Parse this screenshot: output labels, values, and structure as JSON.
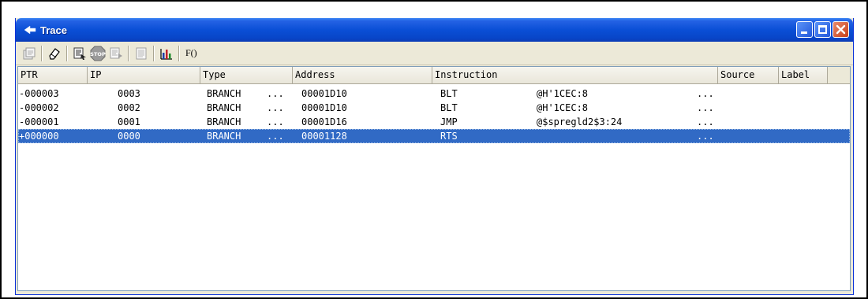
{
  "window": {
    "title": "Trace"
  },
  "toolbar": {
    "buttons": [
      {
        "icon": "properties-icon"
      },
      {
        "icon": "eraser-icon"
      },
      {
        "icon": "trace-acquire-icon"
      },
      {
        "icon": "stop-icon"
      },
      {
        "icon": "trace-restart-icon"
      },
      {
        "icon": "trace-view-icon"
      },
      {
        "icon": "statistics-chart-icon"
      }
    ],
    "function_label": "F()"
  },
  "columns": [
    "PTR",
    "IP",
    "Type",
    "Address",
    "Instruction",
    "Source",
    "Label"
  ],
  "rows": [
    {
      "ptr": "-000003",
      "ip": "0003",
      "type": "BRANCH",
      "more1": "...",
      "address": "00001D10",
      "mnemonic": "BLT",
      "operand": "@H'1CEC:8",
      "more2": "...",
      "selected": false
    },
    {
      "ptr": "-000002",
      "ip": "0002",
      "type": "BRANCH",
      "more1": "...",
      "address": "00001D10",
      "mnemonic": "BLT",
      "operand": "@H'1CEC:8",
      "more2": "...",
      "selected": false
    },
    {
      "ptr": "-000001",
      "ip": "0001",
      "type": "BRANCH",
      "more1": "...",
      "address": "00001D16",
      "mnemonic": "JMP",
      "operand": "@$spregld2$3:24",
      "more2": "...",
      "selected": false
    },
    {
      "ptr": "+000000",
      "ip": "0000",
      "type": "BRANCH",
      "more1": "...",
      "address": "00001128",
      "mnemonic": "RTS",
      "operand": "",
      "more2": "...",
      "selected": true
    }
  ],
  "colors": {
    "selection": "#316ac5",
    "titlebar": "#0a4fd6"
  }
}
